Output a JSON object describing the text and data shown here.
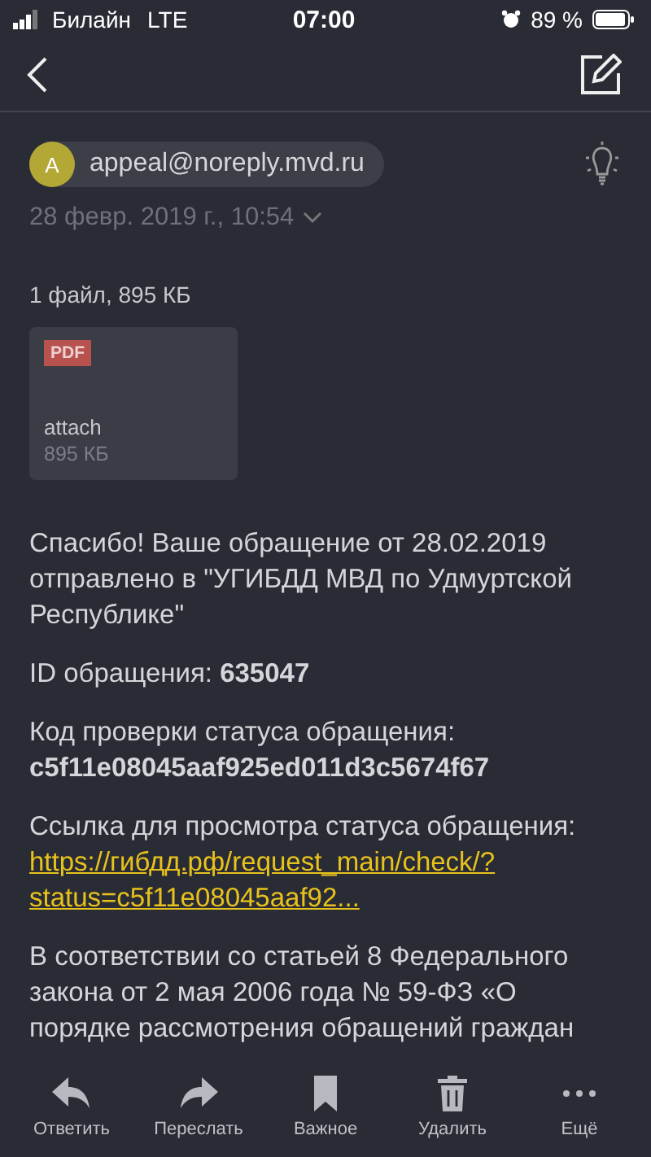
{
  "status_bar": {
    "carrier": "Билайн",
    "network": "LTE",
    "time": "07:00",
    "battery": "89 %"
  },
  "sender": {
    "initial": "A",
    "address": "appeal@noreply.mvd.ru",
    "date": "28 февр. 2019 г., 10:54"
  },
  "attachments": {
    "summary": "1 файл, 895 КБ",
    "files": [
      {
        "type": "PDF",
        "name": "attach",
        "size": "895 КБ"
      }
    ]
  },
  "body": [
    {
      "kind": "text",
      "text": "Спасибо! Ваше обращение от 28.02.2019 отправлено в \"УГИБДД МВД по Удмуртской Республике\""
    },
    {
      "kind": "text",
      "text": "ID обращения: **635047**"
    },
    {
      "kind": "code",
      "label": "Код проверки статуса обращения:",
      "value": "c5f11e08045aaf925ed011d3c5674f67"
    },
    {
      "kind": "link",
      "label": "Ссылка для просмотра статуса обращения:",
      "url": "https://гибдд.рф/request_main/check/?status=c5f11e08045aaf92..."
    },
    {
      "kind": "text",
      "text": "В соответствии со статьей 8 Федерального закона от 2 мая 2006 года № 59-ФЗ «О порядке рассмотрения обращений граждан"
    }
  ],
  "toolbar": [
    {
      "kind": "reply",
      "label": "Ответить"
    },
    {
      "kind": "forward",
      "label": "Переслать"
    },
    {
      "kind": "flag",
      "label": "Важное"
    },
    {
      "kind": "delete",
      "label": "Удалить"
    },
    {
      "kind": "more",
      "label": "Ещё"
    }
  ]
}
